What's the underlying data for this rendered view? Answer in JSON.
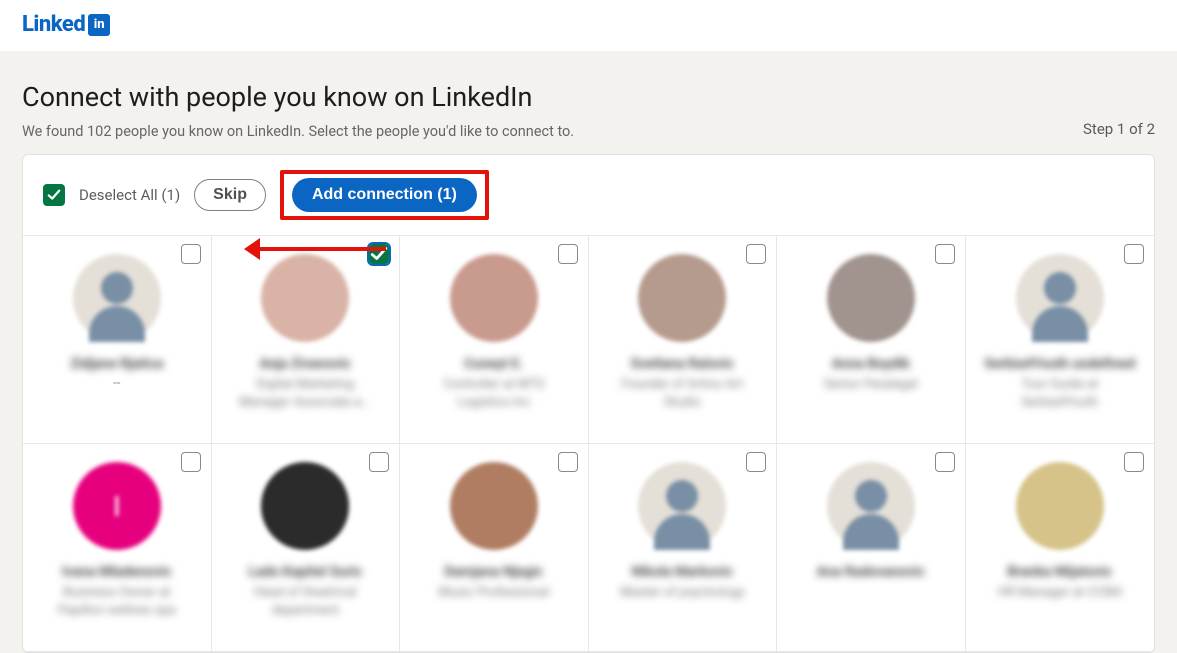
{
  "logo": {
    "text": "Linked",
    "badge": "in"
  },
  "title": "Connect with people you know on LinkedIn",
  "subtitle": "We found 102 people you know on LinkedIn. Select the people you'd like to connect to.",
  "step": "Step 1 of 2",
  "toolbar": {
    "deselect_label": "Deselect All (1)",
    "skip_label": "Skip",
    "add_label": "Add connection (1)"
  },
  "people": [
    {
      "name": "Zidjane Rjatica",
      "role_lines": [],
      "dash": "--",
      "avatar": "default",
      "checked": false
    },
    {
      "name": "Anja Zivanovic",
      "role_lines": [
        "Digital Marketing",
        "Manager Associate a..."
      ],
      "avatar": "photo1",
      "checked": true,
      "arrow": true
    },
    {
      "name": "Cuneyt E.",
      "role_lines": [
        "Controller at MTS",
        "Logistics Inc"
      ],
      "avatar": "photo2",
      "checked": false
    },
    {
      "name": "Svetlana Ralovic",
      "role_lines": [
        "Founder of Artino Art",
        "Studio"
      ],
      "avatar": "photo3",
      "checked": false
    },
    {
      "name": "Anna Boydik",
      "role_lines": [
        "Senior Paralegal"
      ],
      "avatar": "photo4",
      "checked": false
    },
    {
      "name": "Serbia4Youth undefined",
      "role_lines": [
        "Tour Guide at",
        "Serbia4Youth"
      ],
      "avatar": "default",
      "checked": false
    },
    {
      "name": "Ivana Mladenovic",
      "role_lines": [
        "Business Owner at",
        "Papillon wellnes spa"
      ],
      "avatar": "pink",
      "checked": false
    },
    {
      "name": "Lado Kapitel Suric",
      "role_lines": [
        "Head of theatrical",
        "department"
      ],
      "avatar": "photo5",
      "checked": false
    },
    {
      "name": "Damjana Njegic",
      "role_lines": [
        "Music Professional"
      ],
      "avatar": "photo6",
      "checked": false
    },
    {
      "name": "Nikola Markovic",
      "role_lines": [
        "Master of psychology"
      ],
      "avatar": "default",
      "checked": false
    },
    {
      "name": "Ana Radovanovic",
      "role_lines": [
        ""
      ],
      "avatar": "default",
      "checked": false
    },
    {
      "name": "Branka Mijatovic",
      "role_lines": [
        "HR Manager at CCBill"
      ],
      "avatar": "photo7",
      "checked": false
    }
  ],
  "avatar_colors": {
    "photo1": "#d9b3a6",
    "photo2": "#c99a8e",
    "photo3": "#b59a8e",
    "photo4": "#a1938e",
    "photo5": "#2b2b2b",
    "photo6": "#b07d62",
    "photo7": "#d6c38a"
  }
}
